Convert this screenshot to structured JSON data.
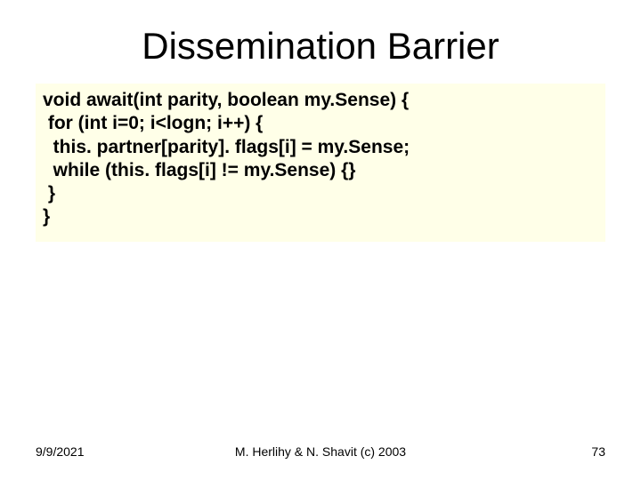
{
  "slide": {
    "title": "Dissemination Barrier",
    "code_lines": [
      "void await(int parity, boolean my.Sense) {",
      " for (int i=0; i<logn; i++) {",
      "  this. partner[parity]. flags[i] = my.Sense;",
      "  while (this. flags[i] != my.Sense) {}",
      " }",
      "}"
    ],
    "footer": {
      "date": "9/9/2021",
      "attribution": "M. Herlihy & N. Shavit (c) 2003",
      "page": "73"
    }
  }
}
